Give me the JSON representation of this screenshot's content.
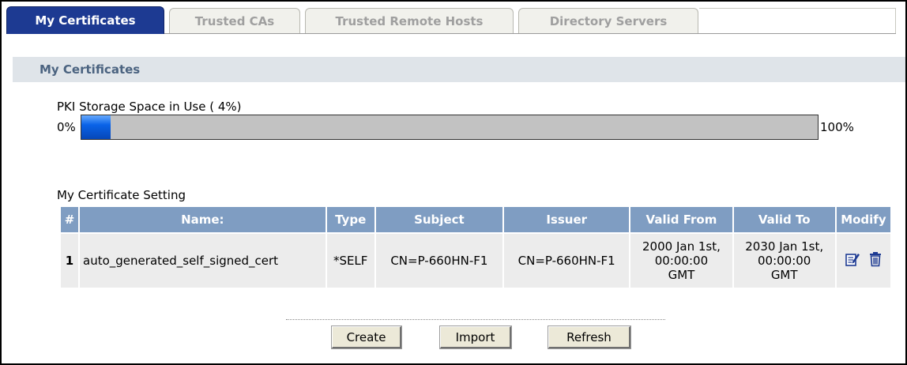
{
  "tabs": [
    {
      "label": "My Certificates",
      "active": true
    },
    {
      "label": "Trusted CAs",
      "active": false
    },
    {
      "label": "Trusted Remote Hosts",
      "active": false
    },
    {
      "label": "Directory Servers",
      "active": false
    }
  ],
  "section": {
    "title": "My Certificates"
  },
  "storage": {
    "label": "PKI Storage Space in Use ( 4%)",
    "min_label": "0%",
    "max_label": "100%",
    "used_fraction": 0.04
  },
  "certificate_setting": {
    "label": "My Certificate Setting",
    "columns": [
      "#",
      "Name:",
      "Type",
      "Subject",
      "Issuer",
      "Valid From",
      "Valid To",
      "Modify"
    ],
    "rows": [
      {
        "num": "1",
        "name": "auto_generated_self_signed_cert",
        "type": "*SELF",
        "subject": "CN=P-660HN-F1",
        "issuer": "CN=P-660HN-F1",
        "valid_from": [
          "2000 Jan 1st,",
          "00:00:00",
          "GMT"
        ],
        "valid_to": [
          "2030 Jan 1st,",
          "00:00:00",
          "GMT"
        ],
        "icons": [
          "edit-icon",
          "delete-icon"
        ]
      }
    ]
  },
  "buttons": {
    "create": "Create",
    "import": "Import",
    "refresh": "Refresh"
  },
  "colors": {
    "tab_active_bg": "#1d3a92",
    "section_header_bg": "#dfe4e9",
    "section_header_text": "#4b6380",
    "table_header_bg": "#7f9dc2",
    "table_row_bg": "#ececec",
    "storage_fill": "#0a63e8",
    "storage_bar_bg": "#c2c2c2"
  }
}
